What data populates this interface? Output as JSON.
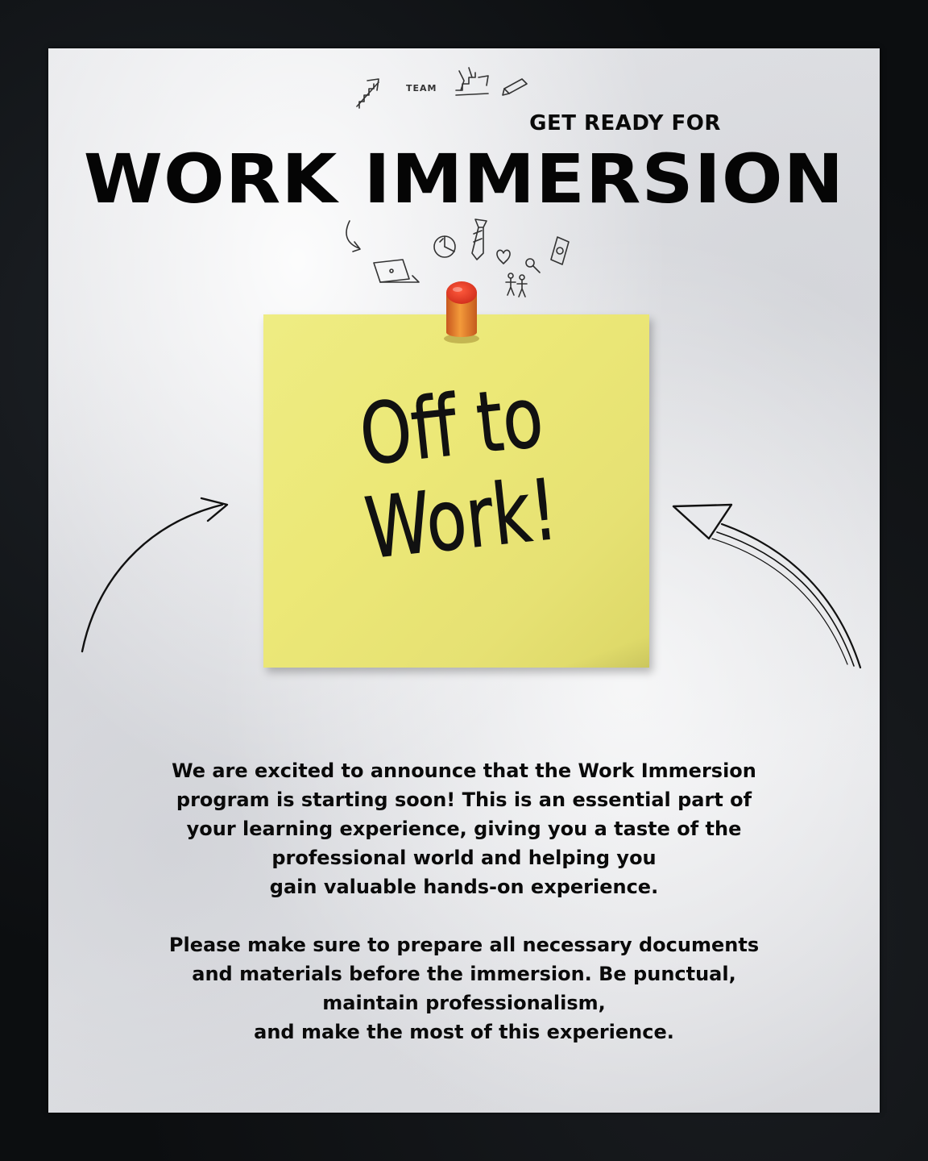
{
  "poster": {
    "kicker": "GET READY FOR",
    "title": "WORK IMMERSION",
    "doodle_label": "TEAM",
    "note_text": "Off to\nWork!",
    "paragraph_1": "We are excited to announce that the Work Immersion\nprogram is starting soon! This is an essential part of\nyour learning experience, giving you a taste of the\nprofessional world and helping you\ngain valuable hands-on experience.",
    "paragraph_2": "Please make sure to prepare all necessary documents\nand materials before the immersion. Be punctual,\nmaintain professionalism,\nand make the most of this experience."
  },
  "colors": {
    "background": "#0c0e10",
    "paper": "#e2e3e6",
    "note": "#ece877",
    "pin": "#e8442a",
    "ink": "#0a0a0a"
  },
  "icons": [
    "arrow-up-icon",
    "team-stairs-icon",
    "pencil-icon",
    "curved-arrow-icon",
    "laptop-icon",
    "pie-chart-icon",
    "necktie-icon",
    "heart-icon",
    "magnifier-icon",
    "money-bill-icon",
    "people-icon",
    "left-arrow-icon",
    "right-arrow-icon",
    "push-pin-icon"
  ]
}
